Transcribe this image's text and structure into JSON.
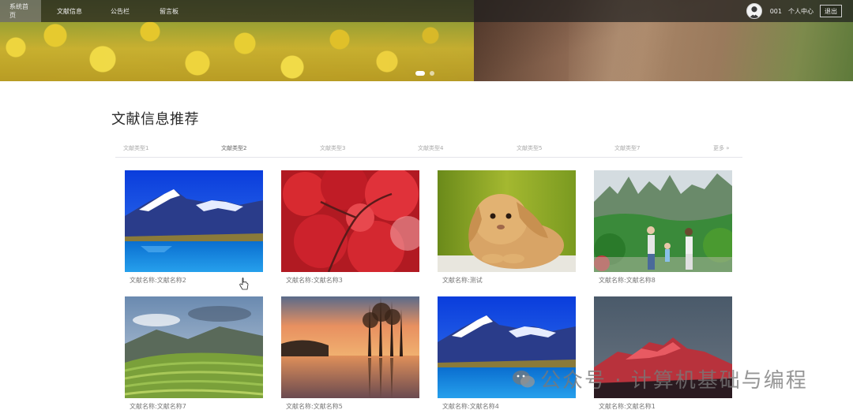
{
  "nav": {
    "items": [
      "系统首页",
      "文献信息",
      "公告栏",
      "留言板"
    ],
    "user": {
      "name": "001",
      "center_label": "个人中心",
      "logout_label": "退出"
    }
  },
  "banner": {
    "slides": 2,
    "active_slide": 0
  },
  "section": {
    "title": "文献信息推荐",
    "categories": [
      "文献类型1",
      "文献类型2",
      "文献类型3",
      "文献类型4",
      "文献类型5",
      "文献类型7"
    ],
    "active_category": "文献类型2",
    "more_label": "更多 »"
  },
  "cards": [
    {
      "caption": "文献名称:文献名称2",
      "image": "mountain-lake"
    },
    {
      "caption": "文献名称:文献名称3",
      "image": "red-maple"
    },
    {
      "caption": "文献名称:测试",
      "image": "rabbit"
    },
    {
      "caption": "文献名称:文献名称8",
      "image": "family-mountains"
    },
    {
      "caption": "文献名称:文献名称7",
      "image": "terraced-hills"
    },
    {
      "caption": "文献名称:文献名称5",
      "image": "sunset-lake"
    },
    {
      "caption": "文献名称:文献名称4",
      "image": "mountain-lake"
    },
    {
      "caption": "文献名称:文献名称1",
      "image": "red-peak"
    }
  ],
  "watermark": "公众号 · 计算机基础与编程"
}
